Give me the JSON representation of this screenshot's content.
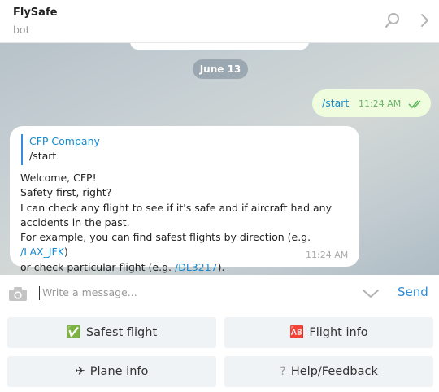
{
  "header": {
    "title": "FlySafe",
    "subtitle": "bot",
    "icons": [
      "search-icon",
      "chevron-right-icon"
    ]
  },
  "chat": {
    "date_label": "June 13",
    "outgoing": {
      "text": "/start",
      "time": "11:24 AM",
      "status_icon": "double-check-icon"
    },
    "incoming": {
      "reply_to": {
        "name": "CFP Company",
        "text": "/start"
      },
      "lines": {
        "l1": "Welcome, CFP!",
        "l2": "Safety first, right?",
        "l3": "I can check any flight to see if it's safe and if aircraft had any",
        "l4": "accidents in the past.",
        "l5_pre": "For example, you can find safest flights by direction (e.g. ",
        "l5_link": "/LAX_JFK",
        "l5_post": ")",
        "l6_pre": "or check particular flight (e.g. ",
        "l6_link": "/DL3217",
        "l6_post": ")."
      },
      "time": "11:24 AM"
    }
  },
  "composer": {
    "placeholder": "Write a message...",
    "send_label": "Send",
    "icons": [
      "camera-icon",
      "chevron-down-icon"
    ]
  },
  "keyboard": {
    "buttons": [
      {
        "emoji": "✅",
        "label": "Safest flight"
      },
      {
        "emoji": "🆎",
        "label": "Flight info"
      },
      {
        "emoji": "✈",
        "label": "Plane info"
      },
      {
        "emoji": "?",
        "label": "Help/Feedback"
      }
    ]
  },
  "colors": {
    "accent": "#168acd",
    "outgoing_bubble": "#effdde",
    "keyboard_button": "#f0f3f5"
  }
}
